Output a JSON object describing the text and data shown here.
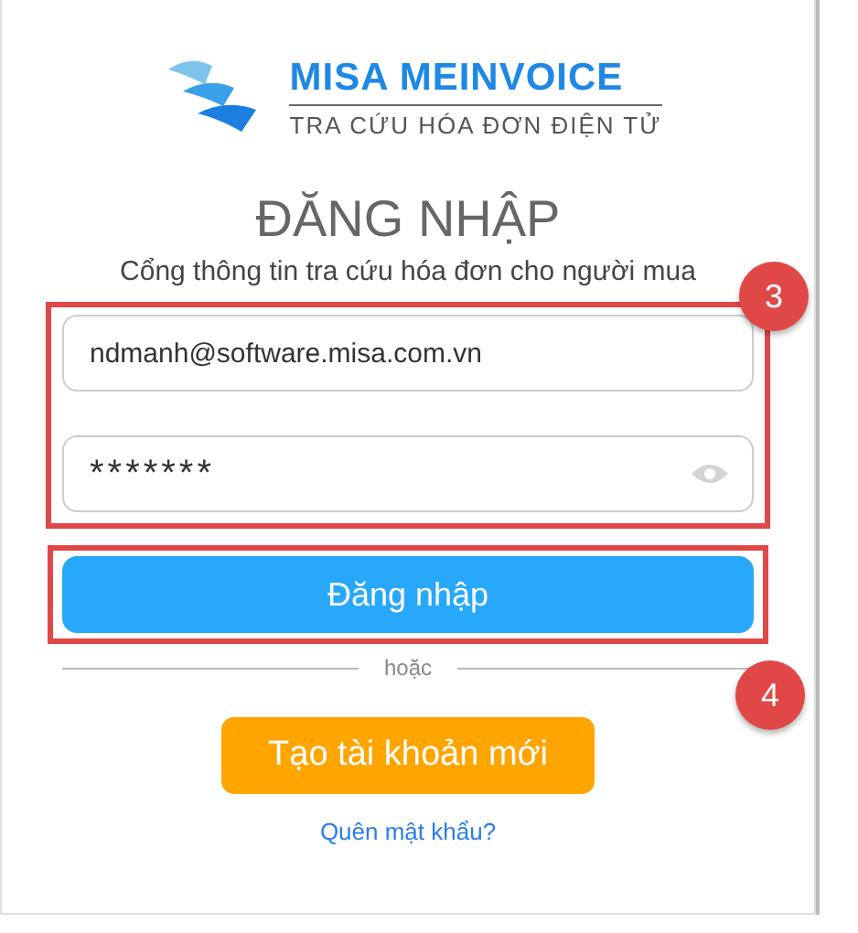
{
  "logo": {
    "brand": "MISA MEINVOICE",
    "tagline": "TRA CỨU HÓA ĐƠN ĐIỆN TỬ"
  },
  "title": "ĐĂNG NHẬP",
  "subtitle": "Cổng thông tin tra cứu hóa đơn cho người mua",
  "email_field": {
    "value": "ndmanh@software.misa.com.vn"
  },
  "password_field": {
    "value": "*******"
  },
  "login_button": "Đăng nhập",
  "divider_text": "hoặc",
  "create_account_button": "Tạo tài khoản mới",
  "forgot_password_link": "Quên mật khẩu?",
  "annotations": [
    {
      "label": "3"
    },
    {
      "label": "4"
    }
  ]
}
